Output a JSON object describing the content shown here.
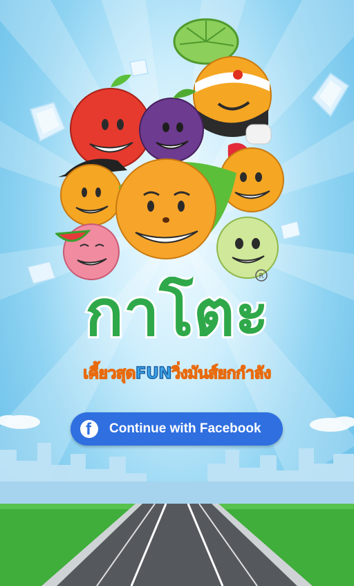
{
  "game": {
    "logo_text": "กาโตะ",
    "tagline_part1": "เคี้ยวสุด",
    "tagline_fun": "FUN",
    "tagline_part2": "วิ่งมันส์ยกกำลัง",
    "registered_mark": "R"
  },
  "login": {
    "facebook_button_label": "Continue with Facebook",
    "facebook_icon": "f"
  },
  "colors": {
    "sky": "#8fd3f2",
    "logo_green": "#2fa84a",
    "facebook_blue": "#2f6fe0",
    "grass": "#3fae3a",
    "road": "#55595e"
  }
}
